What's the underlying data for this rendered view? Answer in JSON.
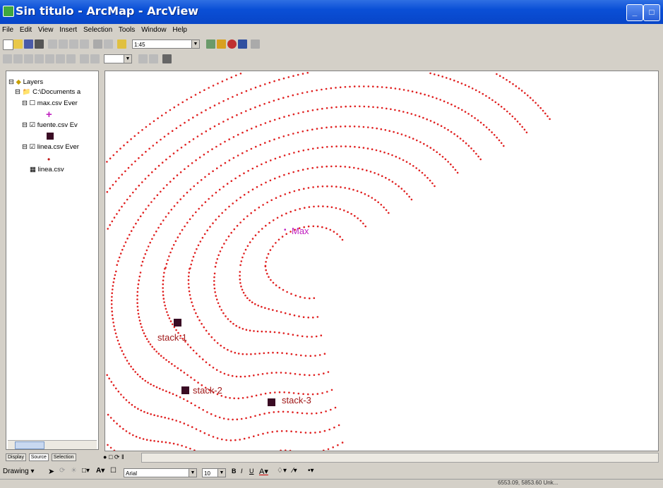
{
  "window": {
    "title": "Sin titulo - ArcMap - ArcView"
  },
  "menu": [
    "File",
    "Edit",
    "View",
    "Insert",
    "Selection",
    "Tools",
    "Window",
    "Help"
  ],
  "toolbar": {
    "scale_value": "1:45"
  },
  "toc": {
    "root_label": "Layers",
    "data_frame_label": "C:\\Documents a",
    "layers": [
      {
        "label": "max.csv Ever",
        "symbol_color": "#c020c0",
        "symbol": "plus"
      },
      {
        "label": "fuente.csv Ev",
        "symbol_color": "#3a0c24",
        "symbol": "square"
      },
      {
        "label": "linea.csv Ever",
        "symbol_color": "#c01818",
        "symbol": "dot"
      }
    ],
    "table_label": "linea.csv"
  },
  "tabs": [
    "Display",
    "Source",
    "Selection"
  ],
  "map": {
    "dot_color": "#e02020",
    "max_color": "#c020c0",
    "stack_color": "#3a0c24",
    "labels": {
      "max": "Max",
      "stack1": "stack-1",
      "stack2": "stack-2",
      "stack3": "stack-3"
    }
  },
  "drawing": {
    "label": "Drawing",
    "font": "Arial",
    "font_size": "10"
  },
  "status": {
    "coordinates": "6553.09, 5853.60 Unk..."
  }
}
